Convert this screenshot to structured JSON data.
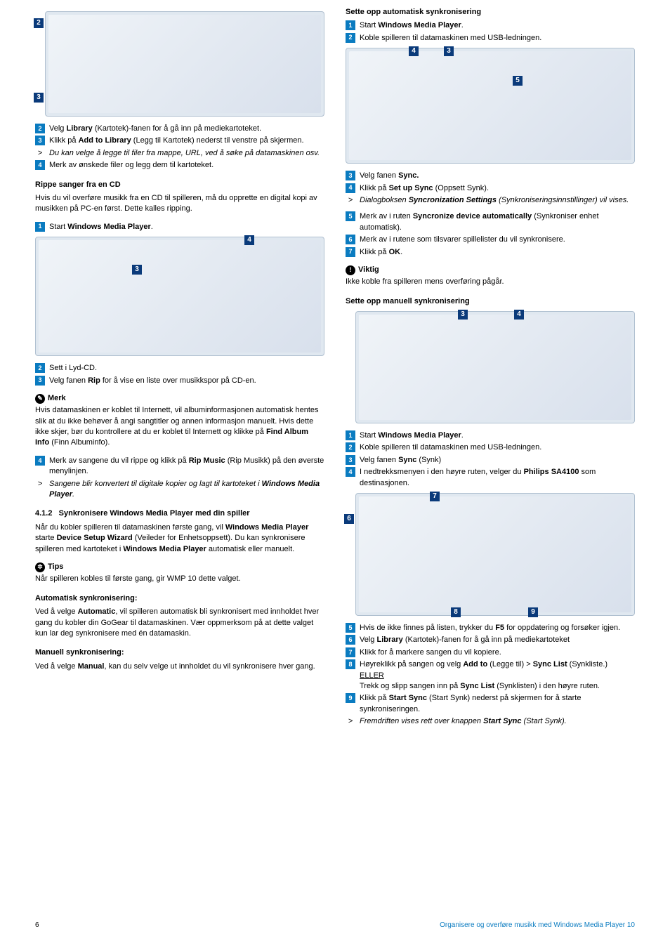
{
  "left": {
    "step2": "Velg ",
    "step2b": "Library",
    "step2c": " (Kartotek)-fanen for å gå inn på mediekartoteket.",
    "step3": "Klikk på ",
    "step3b": "Add to Library",
    "step3c": " (Legg til Kartotek) nederst til venstre på skjermen.",
    "note1": "Du kan velge å legge til filer fra mappe, URL, ved å søke på datamaskinen osv.",
    "step4": "Merk av ønskede filer og legg dem til kartoteket.",
    "rip_title": "Rippe sanger fra en CD",
    "rip_intro": "Hvis du vil overføre musikk fra en CD til spilleren, må du opprette en digital kopi av musikken på PC-en først. Dette kalles ripping.",
    "rip_s1a": "Start ",
    "rip_s1b": "Windows Media Player",
    "rip_s1c": ".",
    "rip_s2": "Sett i Lyd-CD.",
    "rip_s3a": "Velg fanen ",
    "rip_s3b": "Rip",
    "rip_s3c": " for å vise en liste over musikkspor på CD-en.",
    "merk_label": "Merk",
    "merk_body1": "Hvis datamaskinen er koblet til Internett, vil albuminformasjonen automatisk hentes slik at du ikke behøver å angi sangtitler og annen informasjon manuelt. Hvis dette ikke skjer, bør du kontrollere at du er koblet til Internett og klikke på ",
    "merk_body1b": "Find Album Info",
    "merk_body1c": " (Finn Albuminfo).",
    "rip_s4a": "Merk av sangene du vil rippe og klikk på ",
    "rip_s4b": "Rip Music",
    "rip_s4c": " (Rip Musikk) på den øverste menylinjen.",
    "rip_note": "Sangene blir konvertert til digitale kopier og lagt til kartoteket i ",
    "rip_noteb": "Windows Media Player",
    "rip_notec": ".",
    "sec412_num": "4.1.2",
    "sec412_title": "Synkronisere Windows Media Player med din spiller",
    "sync_intro1": "Når du kobler spilleren til datamaskinen første gang, vil ",
    "sync_intro1b": "Windows Media Player",
    "sync_intro1c": " starte ",
    "sync_intro1d": "Device Setup Wizard",
    "sync_intro1e": " (Veileder for Enhetsoppsett). Du kan synkronisere spilleren med kartoteket i ",
    "sync_intro1f": "Windows Media Player",
    "sync_intro1g": " automatisk eller manuelt.",
    "tips_label": "Tips",
    "tips_body": "Når spilleren kobles til første gang, gir WMP 10 dette valget.",
    "auto_title": "Automatisk synkronisering:",
    "auto_body1": "Ved å velge ",
    "auto_body1b": "Automatic",
    "auto_body1c": ", vil spilleren automatisk bli synkronisert med innholdet hver gang du kobler din GoGear til datamaskinen. Vær oppmerksom på at dette valget kun lar deg synkronisere med én datamaskin.",
    "man_title": "Manuell synkronisering:",
    "man_body1": "Ved å velge ",
    "man_body1b": "Manual",
    "man_body1c": ", kan du selv velge ut innholdet du vil synkronisere hver gang."
  },
  "right": {
    "setup_auto_title": "Sette opp automatisk synkronisering",
    "sa1a": "Start ",
    "sa1b": "Windows Media Player",
    "sa1c": ".",
    "sa2": "Koble spilleren til datamaskinen med USB-ledningen.",
    "sa3a": "Velg fanen ",
    "sa3b": "Sync.",
    "sa4a": "Klikk på ",
    "sa4b": "Set up Sync",
    "sa4c": " (Oppsett Synk).",
    "sa_dialog": "Dialogboksen ",
    "sa_dialogb": "Syncronization Settings",
    "sa_dialogc": " (Synkroniseringsinnstillinger) vil vises.",
    "sa5a": "Merk av i ruten ",
    "sa5b": "Syncronize device automatically",
    "sa5c": " (Synkroniser enhet automatisk).",
    "sa6": "Merk av i rutene som tilsvarer spillelister du vil synkronisere.",
    "sa7a": "Klikk på ",
    "sa7b": "OK",
    "sa7c": ".",
    "imp_label": "Viktig",
    "imp_body": "Ikke koble fra spilleren mens overføring pågår.",
    "setup_man_title": "Sette opp manuell synkronisering",
    "sm1a": "Start ",
    "sm1b": "Windows Media Player",
    "sm1c": ".",
    "sm2": "Koble spilleren til datamaskinen med USB-ledningen.",
    "sm3a": "Velg fanen ",
    "sm3b": "Sync",
    "sm3c": " (Synk)",
    "sm4a": " I nedtrekksmenyen i den høyre ruten, velger du ",
    "sm4b": "Philips SA4100",
    "sm4c": " som destinasjonen.",
    "sm5a": "Hvis de ikke finnes på listen, trykker du ",
    "sm5b": "F5",
    "sm5c": " for oppdatering og forsøker igjen.",
    "sm6a": "Velg ",
    "sm6b": "Library",
    "sm6c": " (Kartotek)-fanen for å gå inn på mediekartoteket",
    "sm7": "Klikk for å markere sangen du vil kopiere.",
    "sm8a": "Høyreklikk på sangen og velg ",
    "sm8b": "Add to",
    "sm8c": " (Legge til) > ",
    "sm8d": "Sync List",
    "sm8e": " (Synkliste.)",
    "eller": "ELLER",
    "sm8f": "Trekk og slipp sangen inn på ",
    "sm8g": "Sync List",
    "sm8h": " (Synklisten) i den høyre ruten.",
    "sm9a": "Klikk på ",
    "sm9b": "Start Sync",
    "sm9c": " (Start Synk) nederst på skjermen for å starte synkroniseringen.",
    "sm_prog": "Fremdriften vises rett over knappen ",
    "sm_progb": "Start Sync",
    "sm_progc": " (Start Synk)."
  },
  "footer": {
    "page": "6",
    "section": "Organisere og overføre musikk med Windows Media Player 10"
  },
  "callouts": {
    "n2": "2",
    "n3": "3",
    "n4": "4",
    "n5": "5",
    "n6": "6",
    "n7": "7",
    "n8": "8",
    "n9": "9"
  }
}
